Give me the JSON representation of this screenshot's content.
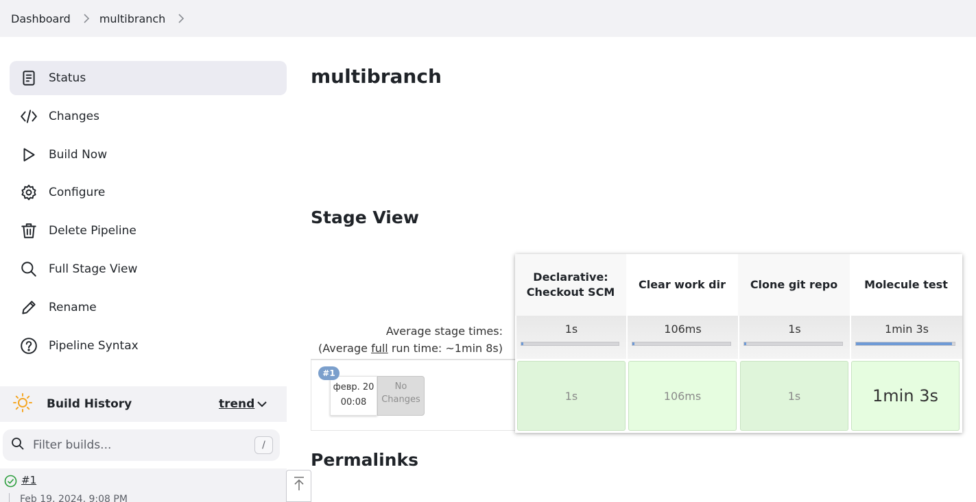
{
  "breadcrumb": {
    "items": [
      "Dashboard",
      "multibranch"
    ]
  },
  "sidebar": {
    "tasks": [
      {
        "label": "Status",
        "icon": "document-icon",
        "active": true
      },
      {
        "label": "Changes",
        "icon": "code-icon"
      },
      {
        "label": "Build Now",
        "icon": "play-icon"
      },
      {
        "label": "Configure",
        "icon": "gear-icon"
      },
      {
        "label": "Delete Pipeline",
        "icon": "trash-icon"
      },
      {
        "label": "Full Stage View",
        "icon": "search-icon"
      },
      {
        "label": "Rename",
        "icon": "pencil-icon"
      },
      {
        "label": "Pipeline Syntax",
        "icon": "help-icon"
      }
    ]
  },
  "build_history": {
    "title": "Build History",
    "trend_label": "trend",
    "filter_placeholder": "Filter builds...",
    "shortcut": "/",
    "builds": [
      {
        "number": "#1",
        "date": "Feb 19, 2024, 9:08 PM",
        "status": "success"
      }
    ]
  },
  "main": {
    "title": "multibranch",
    "stage_view_title": "Stage View",
    "permalinks_title": "Permalinks"
  },
  "stage_view": {
    "avg_label_line1": "Average stage times:",
    "avg_label_line2_pre": "(Average ",
    "avg_label_line2_link": "full",
    "avg_label_line2_post": " run time: ~1min 8s)",
    "stages": [
      {
        "name_line1": "Declarative:",
        "name_line2": "Checkout SCM",
        "avg": "1s",
        "avg_fraction": 0.02,
        "run": "1s"
      },
      {
        "name_line1": "Clear work dir",
        "name_line2": "",
        "avg": "106ms",
        "avg_fraction": 0.01,
        "run": "106ms"
      },
      {
        "name_line1": "Clone git repo",
        "name_line2": "",
        "avg": "1s",
        "avg_fraction": 0.02,
        "run": "1s"
      },
      {
        "name_line1": "Molecule test",
        "name_line2": "",
        "avg": "1min 3s",
        "avg_fraction": 0.97,
        "run": "1min 3s"
      }
    ],
    "run": {
      "badge": "#1",
      "date": "февр. 20",
      "time": "00:08",
      "changes_line1": "No",
      "changes_line2": "Changes"
    },
    "colors": {
      "success_cell": "#dff5da",
      "bar_fill": "#6e9ad6",
      "badge": "#7b9fcc"
    }
  }
}
